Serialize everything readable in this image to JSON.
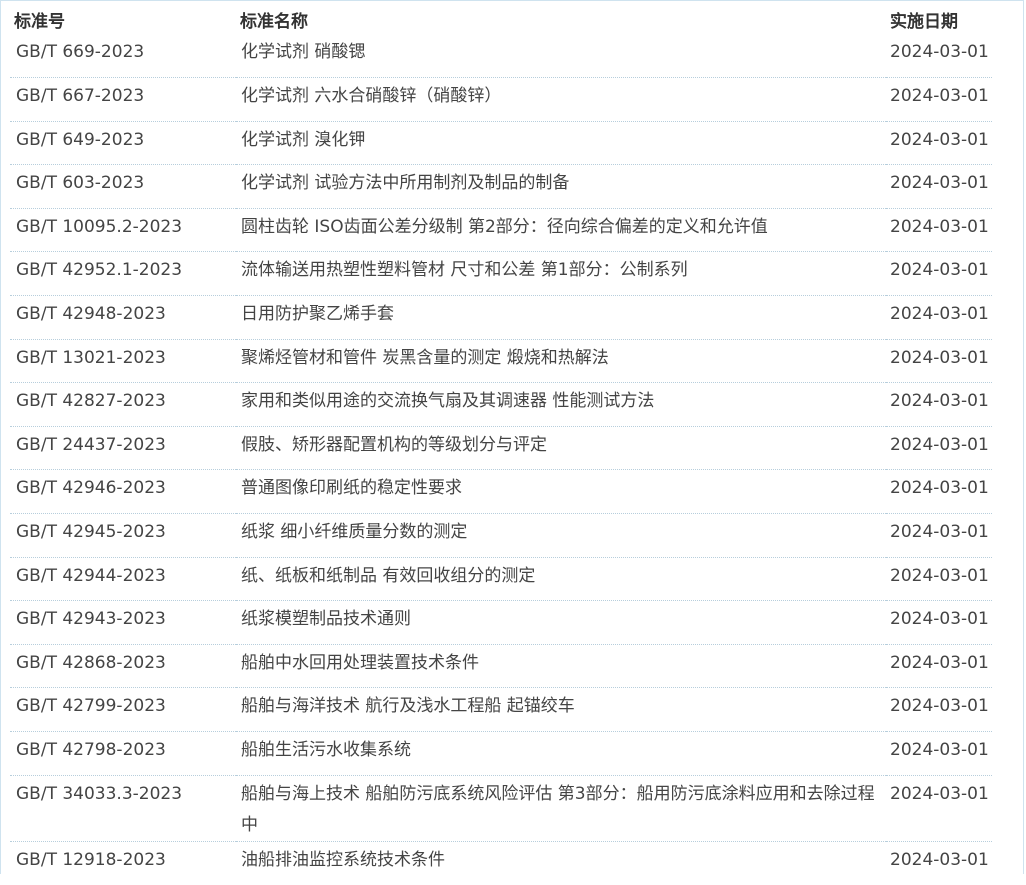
{
  "table": {
    "headers": {
      "code": "标准号",
      "name": "标准名称",
      "date": "实施日期"
    },
    "rows": [
      {
        "code": "GB/T 669-2023",
        "name": "化学试剂 硝酸锶",
        "date": "2024-03-01"
      },
      {
        "code": "GB/T 667-2023",
        "name": "化学试剂 六水合硝酸锌（硝酸锌）",
        "date": "2024-03-01"
      },
      {
        "code": "GB/T 649-2023",
        "name": "化学试剂 溴化钾",
        "date": "2024-03-01"
      },
      {
        "code": "GB/T 603-2023",
        "name": "化学试剂 试验方法中所用制剂及制品的制备",
        "date": "2024-03-01"
      },
      {
        "code": "GB/T 10095.2-2023",
        "name": "圆柱齿轮 ISO齿面公差分级制 第2部分：径向综合偏差的定义和允许值",
        "date": "2024-03-01"
      },
      {
        "code": "GB/T 42952.1-2023",
        "name": "流体输送用热塑性塑料管材 尺寸和公差 第1部分：公制系列",
        "date": "2024-03-01"
      },
      {
        "code": "GB/T 42948-2023",
        "name": "日用防护聚乙烯手套",
        "date": "2024-03-01"
      },
      {
        "code": "GB/T 13021-2023",
        "name": "聚烯烃管材和管件 炭黑含量的测定 煅烧和热解法",
        "date": "2024-03-01"
      },
      {
        "code": "GB/T 42827-2023",
        "name": "家用和类似用途的交流换气扇及其调速器 性能测试方法",
        "date": "2024-03-01"
      },
      {
        "code": "GB/T 24437-2023",
        "name": "假肢、矫形器配置机构的等级划分与评定",
        "date": "2024-03-01"
      },
      {
        "code": "GB/T 42946-2023",
        "name": "普通图像印刷纸的稳定性要求",
        "date": "2024-03-01"
      },
      {
        "code": "GB/T 42945-2023",
        "name": "纸浆 细小纤维质量分数的测定",
        "date": "2024-03-01"
      },
      {
        "code": "GB/T 42944-2023",
        "name": "纸、纸板和纸制品 有效回收组分的测定",
        "date": "2024-03-01"
      },
      {
        "code": "GB/T 42943-2023",
        "name": "纸浆模塑制品技术通则",
        "date": "2024-03-01"
      },
      {
        "code": "GB/T 42868-2023",
        "name": "船舶中水回用处理装置技术条件",
        "date": "2024-03-01"
      },
      {
        "code": "GB/T 42799-2023",
        "name": "船舶与海洋技术 航行及浅水工程船 起锚绞车",
        "date": "2024-03-01"
      },
      {
        "code": "GB/T 42798-2023",
        "name": "船舶生活污水收集系统",
        "date": "2024-03-01"
      },
      {
        "code": "GB/T 34033.3-2023",
        "name": "船舶与海上技术 船舶防污底系统风险评估 第3部分：船用防污底涂料应用和去除过程中",
        "date": "2024-03-01"
      },
      {
        "code": "GB/T 12918-2023",
        "name": "油船排油监控系统技术条件",
        "date": "2024-03-01"
      }
    ]
  }
}
